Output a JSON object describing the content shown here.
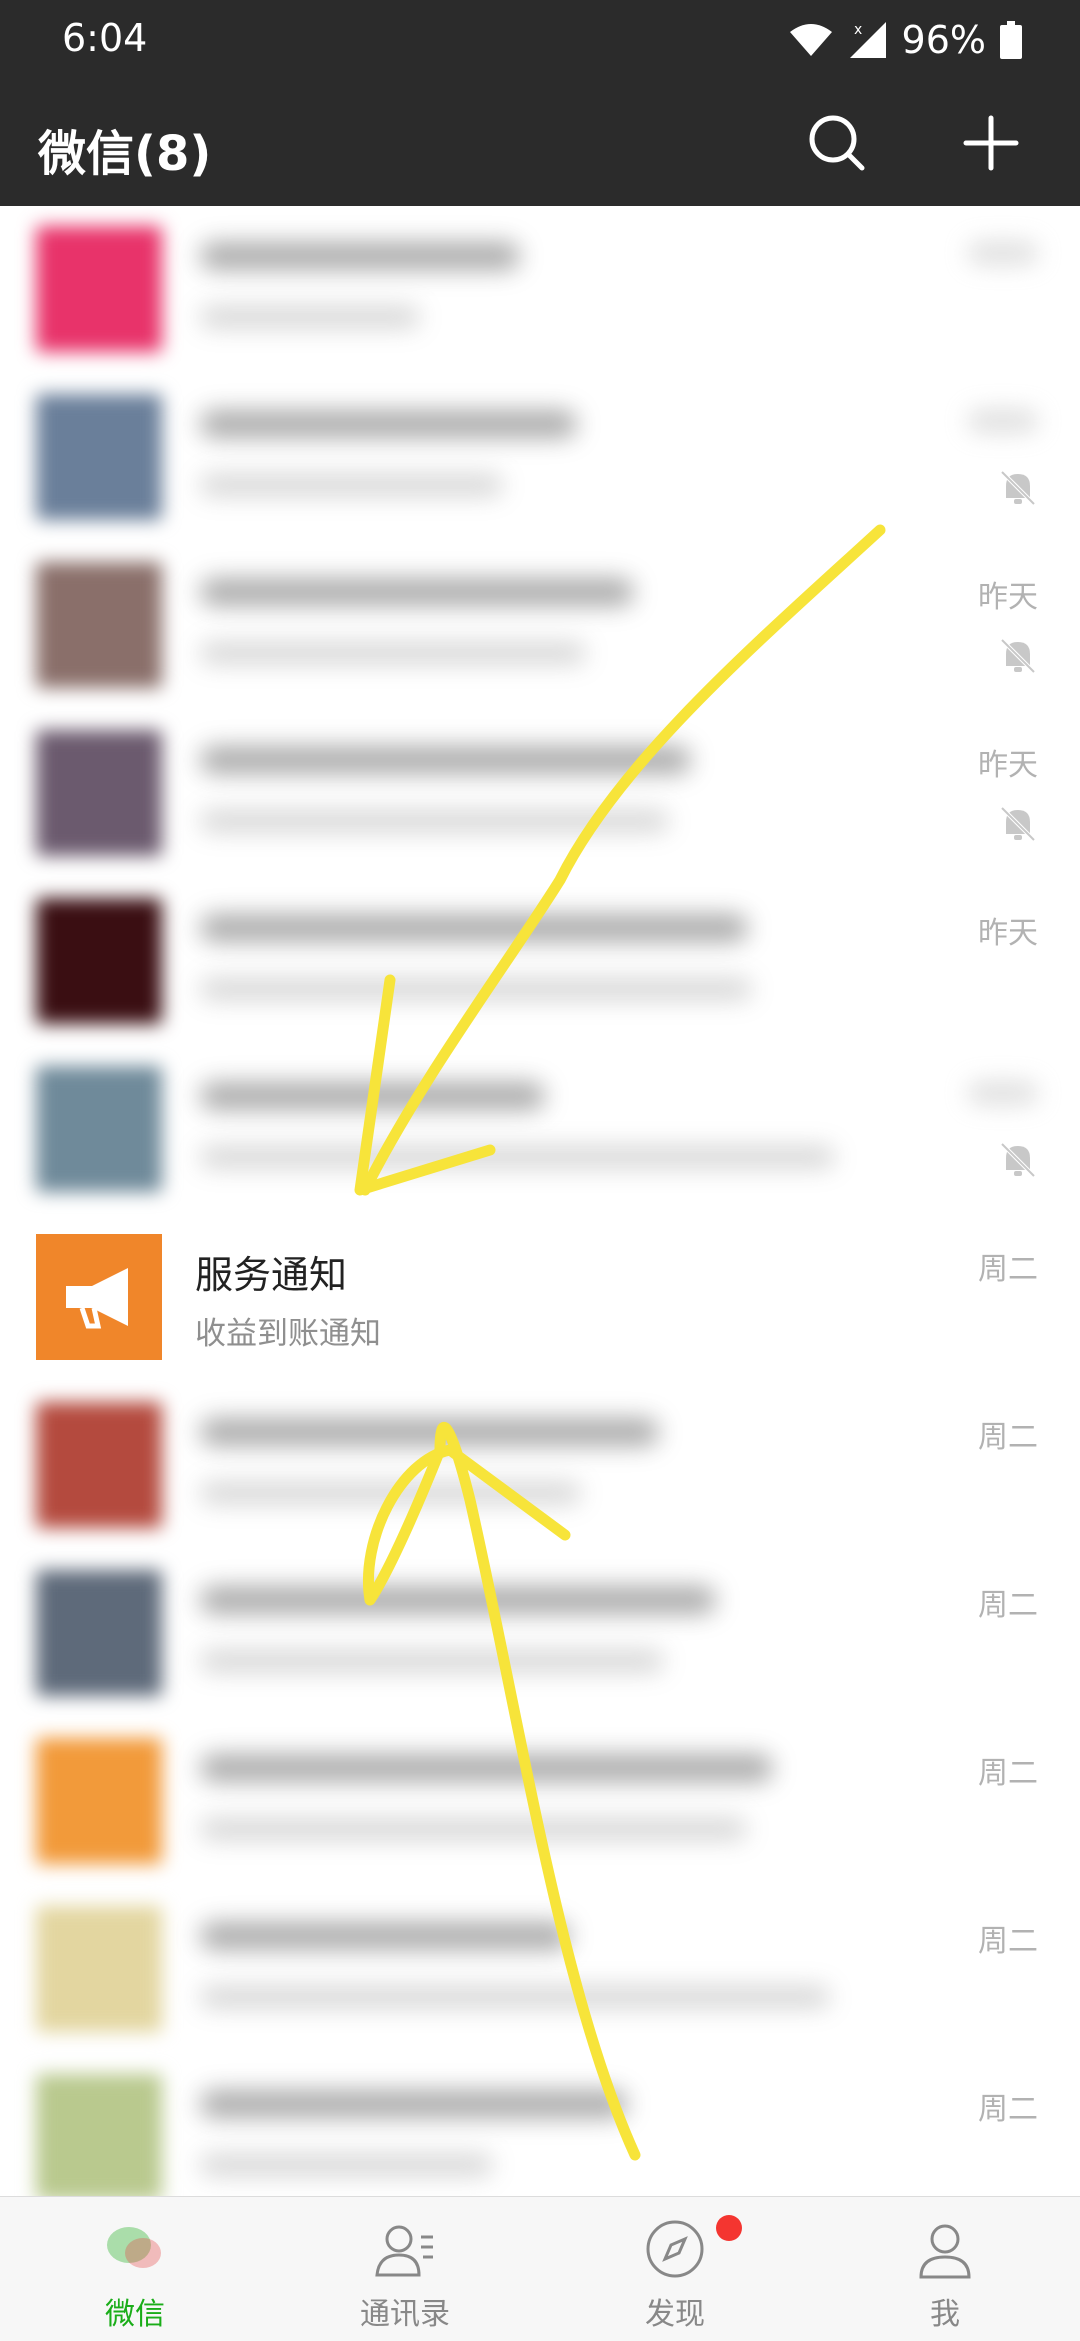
{
  "status_bar": {
    "time": "6:04",
    "battery": "96%"
  },
  "header": {
    "title": "微信(8)"
  },
  "chats": [
    {
      "blurred": true,
      "time": "",
      "muted": false,
      "avatar_color": "#e8336a"
    },
    {
      "blurred": true,
      "time": "",
      "muted": true,
      "avatar_color": "#6a7f9a"
    },
    {
      "blurred": true,
      "time": "昨天",
      "muted": true,
      "avatar_color": "#8a6f6a"
    },
    {
      "blurred": true,
      "time": "昨天",
      "muted": true,
      "avatar_color": "#6b5a6e"
    },
    {
      "blurred": true,
      "time": "昨天",
      "muted": false,
      "avatar_color": "#3a0e12"
    },
    {
      "blurred": true,
      "time": "",
      "muted": true,
      "avatar_color": "#6f8a9a"
    },
    {
      "blurred": false,
      "title": "服务通知",
      "subtitle": "收益到账通知",
      "time": "周二",
      "muted": false,
      "avatar_color": "#f0862a"
    },
    {
      "blurred": true,
      "time": "周二",
      "muted": false,
      "avatar_color": "#b44a3e"
    },
    {
      "blurred": true,
      "time": "周二",
      "muted": false,
      "avatar_color": "#5e6a7a"
    },
    {
      "blurred": true,
      "time": "周二",
      "muted": false,
      "avatar_color": "#f29a3a"
    },
    {
      "blurred": true,
      "time": "周二",
      "muted": false,
      "avatar_color": "#e3d6a0"
    },
    {
      "blurred": true,
      "time": "周二",
      "muted": false,
      "avatar_color": "#b9c98e"
    }
  ],
  "tabs": [
    {
      "label": "微信",
      "icon": "chat-icon",
      "active": true
    },
    {
      "label": "通讯录",
      "icon": "contacts-icon",
      "active": false
    },
    {
      "label": "发现",
      "icon": "compass-icon",
      "active": false,
      "badge": true
    },
    {
      "label": "我",
      "icon": "profile-icon",
      "active": false
    }
  ],
  "colors": {
    "header_bg": "#2b2b2b",
    "accent_green": "#1aad19",
    "service_orange": "#f0862a",
    "annotation_yellow": "#f7e43a",
    "badge_red": "#f43530"
  }
}
